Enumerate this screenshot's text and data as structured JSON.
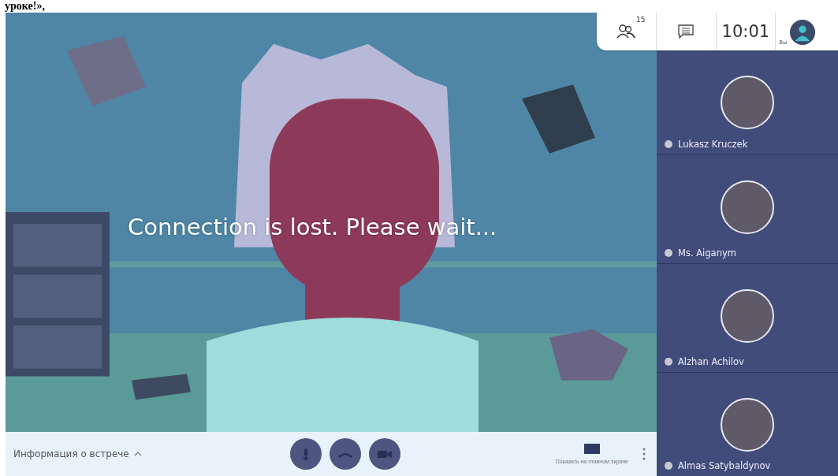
{
  "caption_fragment": "уроке!»,",
  "top_bar": {
    "participants_count": "15",
    "time": "10:01",
    "self_label": "Вы"
  },
  "video": {
    "kind": "picture",
    "message": "Connection is lost. Please wait..."
  },
  "participants": [
    {
      "name": "Lukasz Kruczek"
    },
    {
      "name": "Ms. Aiganym"
    },
    {
      "name": "Alzhan Achilov"
    },
    {
      "name": "Almas Satybaldynov"
    }
  ],
  "bottom_bar": {
    "meeting_info": "Информация о встрече",
    "show_on_main": "Показать на главном экране"
  }
}
